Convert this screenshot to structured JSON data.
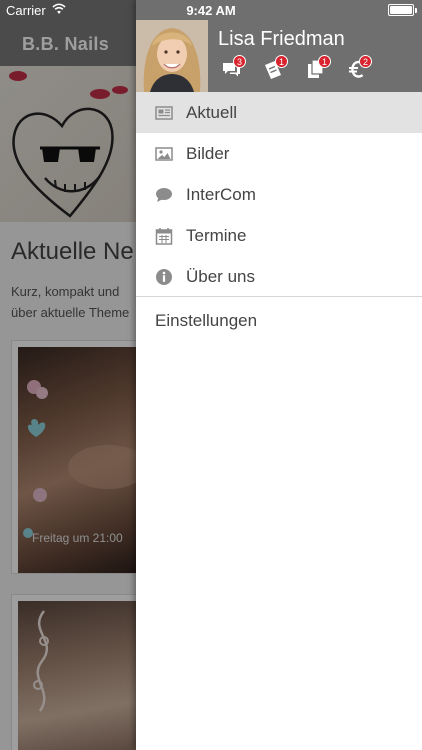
{
  "status_bar": {
    "carrier": "Carrier",
    "time": "9:42 AM",
    "battery_level": 1.0
  },
  "background_app": {
    "title": "B.B. Nails",
    "heading": "Aktuelle Ne",
    "intro_line1": "Kurz, kompakt und",
    "intro_line2": "über aktuelle Theme",
    "card_caption": "Freitag um 21:00"
  },
  "drawer": {
    "user_name": "Lisa Friedman",
    "header_icons": [
      {
        "icon": "chat-icon",
        "badge": "3"
      },
      {
        "icon": "coupon-icon",
        "badge": "1"
      },
      {
        "icon": "documents-icon",
        "badge": "1"
      },
      {
        "icon": "euro-icon",
        "badge": "2"
      }
    ],
    "menu_items": [
      {
        "icon": "newspaper-icon",
        "label": "Aktuell",
        "active": true
      },
      {
        "icon": "image-icon",
        "label": "Bilder",
        "active": false
      },
      {
        "icon": "chat-bubble-icon",
        "label": "InterCom",
        "active": false
      },
      {
        "icon": "calendar-icon",
        "label": "Termine",
        "active": false
      },
      {
        "icon": "info-icon",
        "label": "Über uns",
        "active": false
      }
    ],
    "settings_label": "Einstellungen"
  },
  "colors": {
    "drawer_header": "#6f6f6f",
    "active_item": "#e2e2e2",
    "badge": "#d9232e",
    "menu_icon": "#8c8c8c"
  }
}
